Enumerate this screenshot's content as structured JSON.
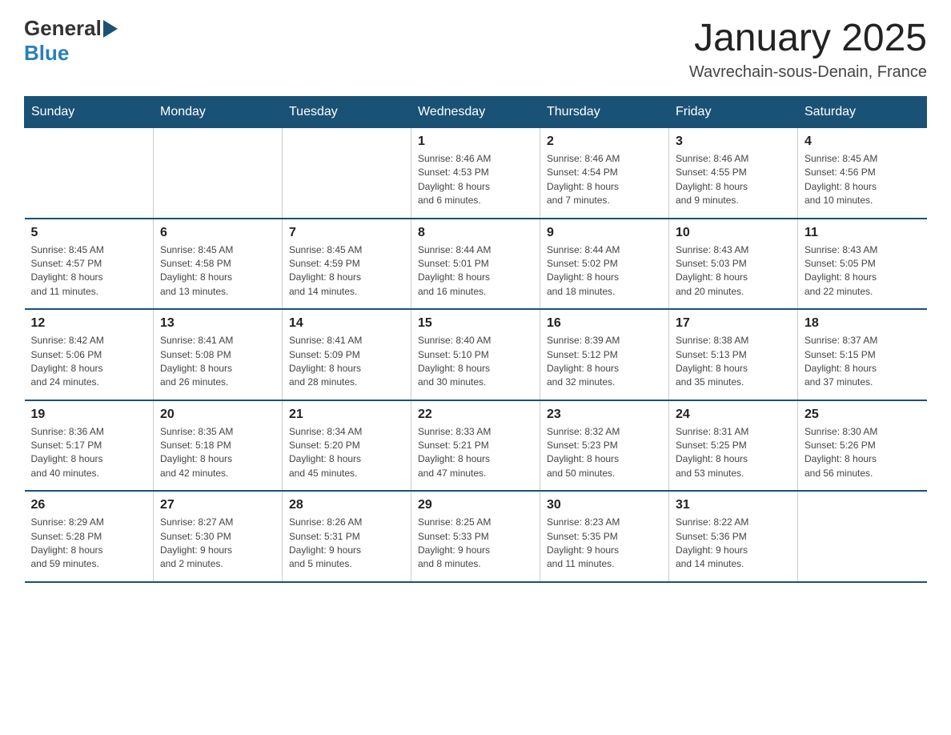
{
  "header": {
    "logo_general": "General",
    "logo_blue": "Blue",
    "title": "January 2025",
    "subtitle": "Wavrechain-sous-Denain, France"
  },
  "days_of_week": [
    "Sunday",
    "Monday",
    "Tuesday",
    "Wednesday",
    "Thursday",
    "Friday",
    "Saturday"
  ],
  "weeks": [
    [
      {
        "day": "",
        "info": ""
      },
      {
        "day": "",
        "info": ""
      },
      {
        "day": "",
        "info": ""
      },
      {
        "day": "1",
        "info": "Sunrise: 8:46 AM\nSunset: 4:53 PM\nDaylight: 8 hours\nand 6 minutes."
      },
      {
        "day": "2",
        "info": "Sunrise: 8:46 AM\nSunset: 4:54 PM\nDaylight: 8 hours\nand 7 minutes."
      },
      {
        "day": "3",
        "info": "Sunrise: 8:46 AM\nSunset: 4:55 PM\nDaylight: 8 hours\nand 9 minutes."
      },
      {
        "day": "4",
        "info": "Sunrise: 8:45 AM\nSunset: 4:56 PM\nDaylight: 8 hours\nand 10 minutes."
      }
    ],
    [
      {
        "day": "5",
        "info": "Sunrise: 8:45 AM\nSunset: 4:57 PM\nDaylight: 8 hours\nand 11 minutes."
      },
      {
        "day": "6",
        "info": "Sunrise: 8:45 AM\nSunset: 4:58 PM\nDaylight: 8 hours\nand 13 minutes."
      },
      {
        "day": "7",
        "info": "Sunrise: 8:45 AM\nSunset: 4:59 PM\nDaylight: 8 hours\nand 14 minutes."
      },
      {
        "day": "8",
        "info": "Sunrise: 8:44 AM\nSunset: 5:01 PM\nDaylight: 8 hours\nand 16 minutes."
      },
      {
        "day": "9",
        "info": "Sunrise: 8:44 AM\nSunset: 5:02 PM\nDaylight: 8 hours\nand 18 minutes."
      },
      {
        "day": "10",
        "info": "Sunrise: 8:43 AM\nSunset: 5:03 PM\nDaylight: 8 hours\nand 20 minutes."
      },
      {
        "day": "11",
        "info": "Sunrise: 8:43 AM\nSunset: 5:05 PM\nDaylight: 8 hours\nand 22 minutes."
      }
    ],
    [
      {
        "day": "12",
        "info": "Sunrise: 8:42 AM\nSunset: 5:06 PM\nDaylight: 8 hours\nand 24 minutes."
      },
      {
        "day": "13",
        "info": "Sunrise: 8:41 AM\nSunset: 5:08 PM\nDaylight: 8 hours\nand 26 minutes."
      },
      {
        "day": "14",
        "info": "Sunrise: 8:41 AM\nSunset: 5:09 PM\nDaylight: 8 hours\nand 28 minutes."
      },
      {
        "day": "15",
        "info": "Sunrise: 8:40 AM\nSunset: 5:10 PM\nDaylight: 8 hours\nand 30 minutes."
      },
      {
        "day": "16",
        "info": "Sunrise: 8:39 AM\nSunset: 5:12 PM\nDaylight: 8 hours\nand 32 minutes."
      },
      {
        "day": "17",
        "info": "Sunrise: 8:38 AM\nSunset: 5:13 PM\nDaylight: 8 hours\nand 35 minutes."
      },
      {
        "day": "18",
        "info": "Sunrise: 8:37 AM\nSunset: 5:15 PM\nDaylight: 8 hours\nand 37 minutes."
      }
    ],
    [
      {
        "day": "19",
        "info": "Sunrise: 8:36 AM\nSunset: 5:17 PM\nDaylight: 8 hours\nand 40 minutes."
      },
      {
        "day": "20",
        "info": "Sunrise: 8:35 AM\nSunset: 5:18 PM\nDaylight: 8 hours\nand 42 minutes."
      },
      {
        "day": "21",
        "info": "Sunrise: 8:34 AM\nSunset: 5:20 PM\nDaylight: 8 hours\nand 45 minutes."
      },
      {
        "day": "22",
        "info": "Sunrise: 8:33 AM\nSunset: 5:21 PM\nDaylight: 8 hours\nand 47 minutes."
      },
      {
        "day": "23",
        "info": "Sunrise: 8:32 AM\nSunset: 5:23 PM\nDaylight: 8 hours\nand 50 minutes."
      },
      {
        "day": "24",
        "info": "Sunrise: 8:31 AM\nSunset: 5:25 PM\nDaylight: 8 hours\nand 53 minutes."
      },
      {
        "day": "25",
        "info": "Sunrise: 8:30 AM\nSunset: 5:26 PM\nDaylight: 8 hours\nand 56 minutes."
      }
    ],
    [
      {
        "day": "26",
        "info": "Sunrise: 8:29 AM\nSunset: 5:28 PM\nDaylight: 8 hours\nand 59 minutes."
      },
      {
        "day": "27",
        "info": "Sunrise: 8:27 AM\nSunset: 5:30 PM\nDaylight: 9 hours\nand 2 minutes."
      },
      {
        "day": "28",
        "info": "Sunrise: 8:26 AM\nSunset: 5:31 PM\nDaylight: 9 hours\nand 5 minutes."
      },
      {
        "day": "29",
        "info": "Sunrise: 8:25 AM\nSunset: 5:33 PM\nDaylight: 9 hours\nand 8 minutes."
      },
      {
        "day": "30",
        "info": "Sunrise: 8:23 AM\nSunset: 5:35 PM\nDaylight: 9 hours\nand 11 minutes."
      },
      {
        "day": "31",
        "info": "Sunrise: 8:22 AM\nSunset: 5:36 PM\nDaylight: 9 hours\nand 14 minutes."
      },
      {
        "day": "",
        "info": ""
      }
    ]
  ]
}
